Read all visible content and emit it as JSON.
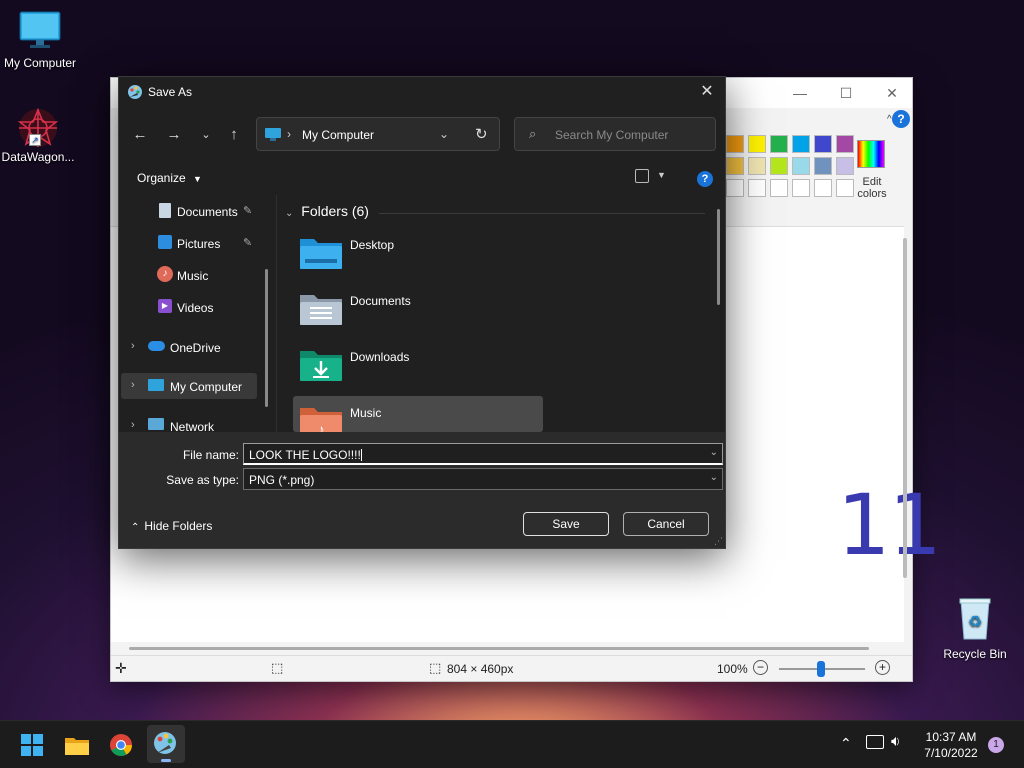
{
  "desktop": {
    "icons": [
      {
        "label": "My Computer",
        "icon": "monitor-icon"
      },
      {
        "label": "DataWagon...",
        "icon": "datawagon-logo-icon"
      },
      {
        "label": "Recycle Bin",
        "icon": "recycle-bin-icon"
      }
    ]
  },
  "paint": {
    "title_controls": {
      "minimize": "—",
      "maximize": "☐",
      "close": "✕"
    },
    "help": "?",
    "edit_colors": "Edit colors",
    "canvas_text": "11",
    "status": {
      "selection_size": "804 × 460px",
      "zoom": "100%"
    },
    "colors": {
      "row1": [
        "#f39c12",
        "#fff200",
        "#22b14c",
        "#00a2e8",
        "#3f48cc",
        "#a349a4"
      ],
      "row2": [
        "#f5c242",
        "#efe4b0",
        "#b5e61d",
        "#99d9ea",
        "#7092be",
        "#c8bfe7"
      ],
      "row3": [
        "#ffffff",
        "#ffffff",
        "#ffffff",
        "#ffffff",
        "#ffffff",
        "#ffffff"
      ]
    }
  },
  "dialog": {
    "title": "Save As",
    "address": {
      "location": "My Computer"
    },
    "search": {
      "placeholder": "Search My Computer"
    },
    "toolbar": {
      "organize": "Organize"
    },
    "nav": {
      "items": [
        {
          "label": "Documents",
          "icon": "documents-icon",
          "pinned": true
        },
        {
          "label": "Pictures",
          "icon": "pictures-icon",
          "pinned": true
        },
        {
          "label": "Music",
          "icon": "music-icon",
          "pinned": false
        },
        {
          "label": "Videos",
          "icon": "videos-icon",
          "pinned": false
        },
        {
          "label": "OneDrive",
          "icon": "onedrive-icon",
          "pinned": false
        },
        {
          "label": "My Computer",
          "icon": "computer-icon",
          "pinned": false
        },
        {
          "label": "Network",
          "icon": "network-icon",
          "pinned": false
        }
      ]
    },
    "content": {
      "group_header": "Folders (6)",
      "folders": [
        {
          "name": "Desktop",
          "icon": "desktop-folder-icon"
        },
        {
          "name": "Documents",
          "icon": "documents-folder-icon"
        },
        {
          "name": "Downloads",
          "icon": "downloads-folder-icon"
        },
        {
          "name": "Music",
          "icon": "music-folder-icon"
        }
      ]
    },
    "file_name_label": "File name:",
    "file_name_value": "LOOK THE LOGO!!!!",
    "save_type_label": "Save as type:",
    "save_type_value": "PNG (*.png)",
    "hide_folders": "Hide Folders",
    "save_button": "Save",
    "cancel_button": "Cancel"
  },
  "taskbar": {
    "time": "10:37 AM",
    "date": "7/10/2022",
    "notification_count": "1",
    "apps": [
      "start-icon",
      "file-explorer-icon",
      "chrome-icon",
      "paint-icon"
    ]
  }
}
